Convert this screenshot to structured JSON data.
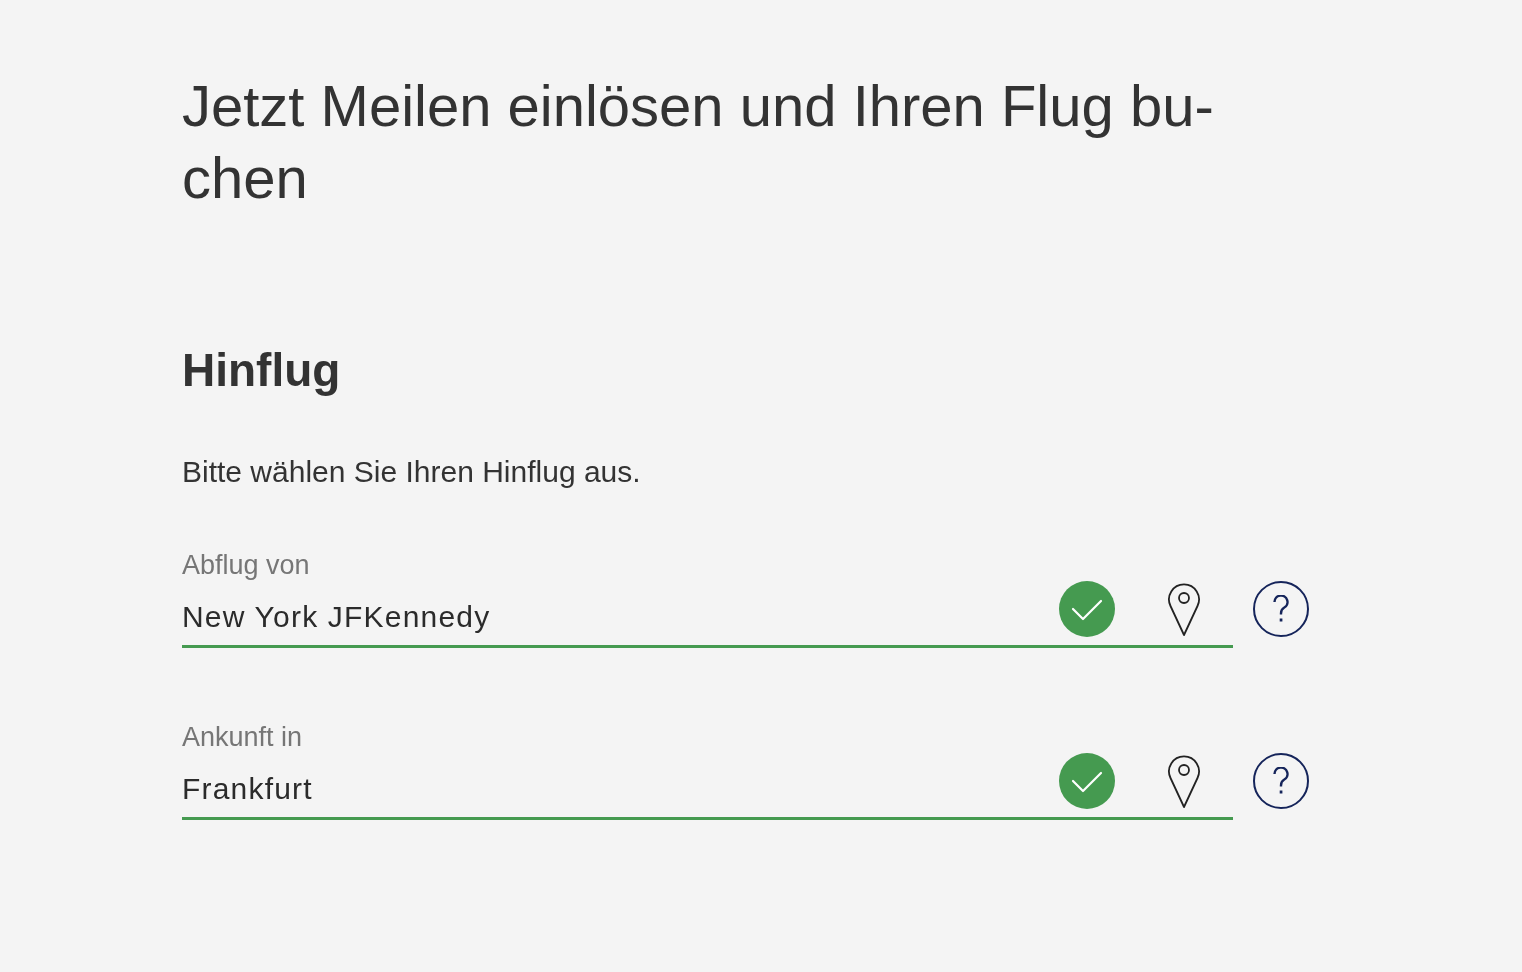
{
  "heading": "Jetzt Meilen einlösen und Ihren Flug bu-chen",
  "section": {
    "title": "Hinflug",
    "instruction": "Bitte wählen Sie Ihren Hinflug aus.",
    "fields": [
      {
        "label": "Abflug von",
        "value": "New York JFKennedy",
        "valid": true
      },
      {
        "label": "Ankunft in",
        "value": "Frankfurt",
        "valid": true
      }
    ]
  }
}
